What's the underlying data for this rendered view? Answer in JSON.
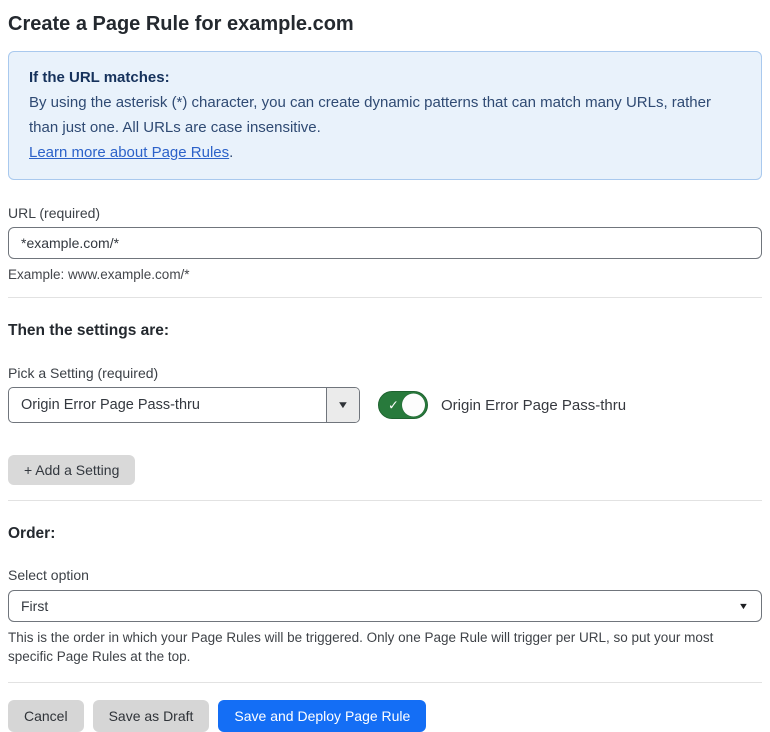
{
  "page": {
    "title": "Create a Page Rule for example.com"
  },
  "info_box": {
    "heading": "If the URL matches:",
    "body": "By using the asterisk (*) character, you can create dynamic patterns that can match many URLs, rather than just one. All URLs are case insensitive.",
    "link": "Learn more about Page Rules",
    "link_suffix": "."
  },
  "url_field": {
    "label": "URL (required)",
    "value": "*example.com/*",
    "helper": "Example: www.example.com/*"
  },
  "settings_section": {
    "heading": "Then the settings are:",
    "setting_label": "Pick a Setting (required)",
    "setting_value": "Origin Error Page Pass-thru",
    "toggle_state": "on",
    "toggle_check": "✓",
    "toggle_label": "Origin Error Page Pass-thru",
    "add_button": "+ Add a Setting"
  },
  "order_section": {
    "heading": "Order:",
    "select_label": "Select option",
    "select_value": "First",
    "helper": "This is the order in which your Page Rules will be triggered. Only one Page Rule will trigger per URL, so put your most specific Page Rules at the top."
  },
  "footer": {
    "cancel": "Cancel",
    "save_draft": "Save as Draft",
    "save_deploy": "Save and Deploy Page Rule"
  },
  "icons": {
    "dropdown_arrow": "▼",
    "select_arrow": "▼"
  },
  "colors": {
    "accent_blue": "#146ef5",
    "toggle_green": "#287a3c",
    "info_bg": "#e9f2fb",
    "info_border": "#a9c9ee",
    "link_blue": "#2c62c9"
  }
}
